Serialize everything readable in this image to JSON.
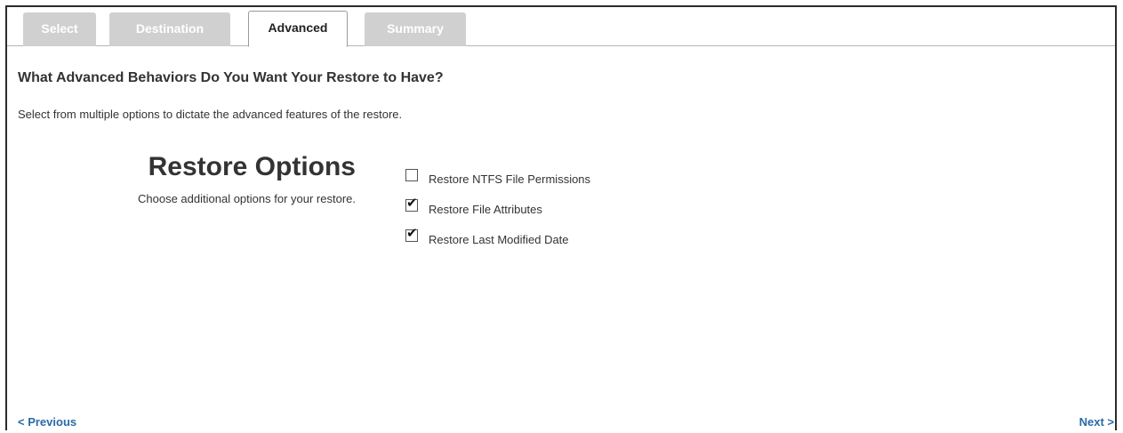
{
  "tabs": [
    {
      "label": "Select",
      "active": false
    },
    {
      "label": "Destination",
      "active": false
    },
    {
      "label": "Advanced",
      "active": true
    },
    {
      "label": "Summary",
      "active": false
    }
  ],
  "page": {
    "heading": "What Advanced Behaviors Do You Want Your Restore to Have?",
    "subtext": "Select from multiple options to dictate the advanced features of the restore."
  },
  "restore_options": {
    "title": "Restore Options",
    "description": "Choose additional options for your restore.",
    "options": [
      {
        "label": "Restore NTFS File Permissions",
        "checked": false
      },
      {
        "label": "Restore File Attributes",
        "checked": true
      },
      {
        "label": "Restore Last Modified Date",
        "checked": true
      }
    ]
  },
  "nav": {
    "previous_label": "< Previous",
    "next_label": "Next >"
  },
  "colors": {
    "link": "#2a6aa5",
    "inactive_tab": "#d0d0d0",
    "text": "#333333"
  }
}
